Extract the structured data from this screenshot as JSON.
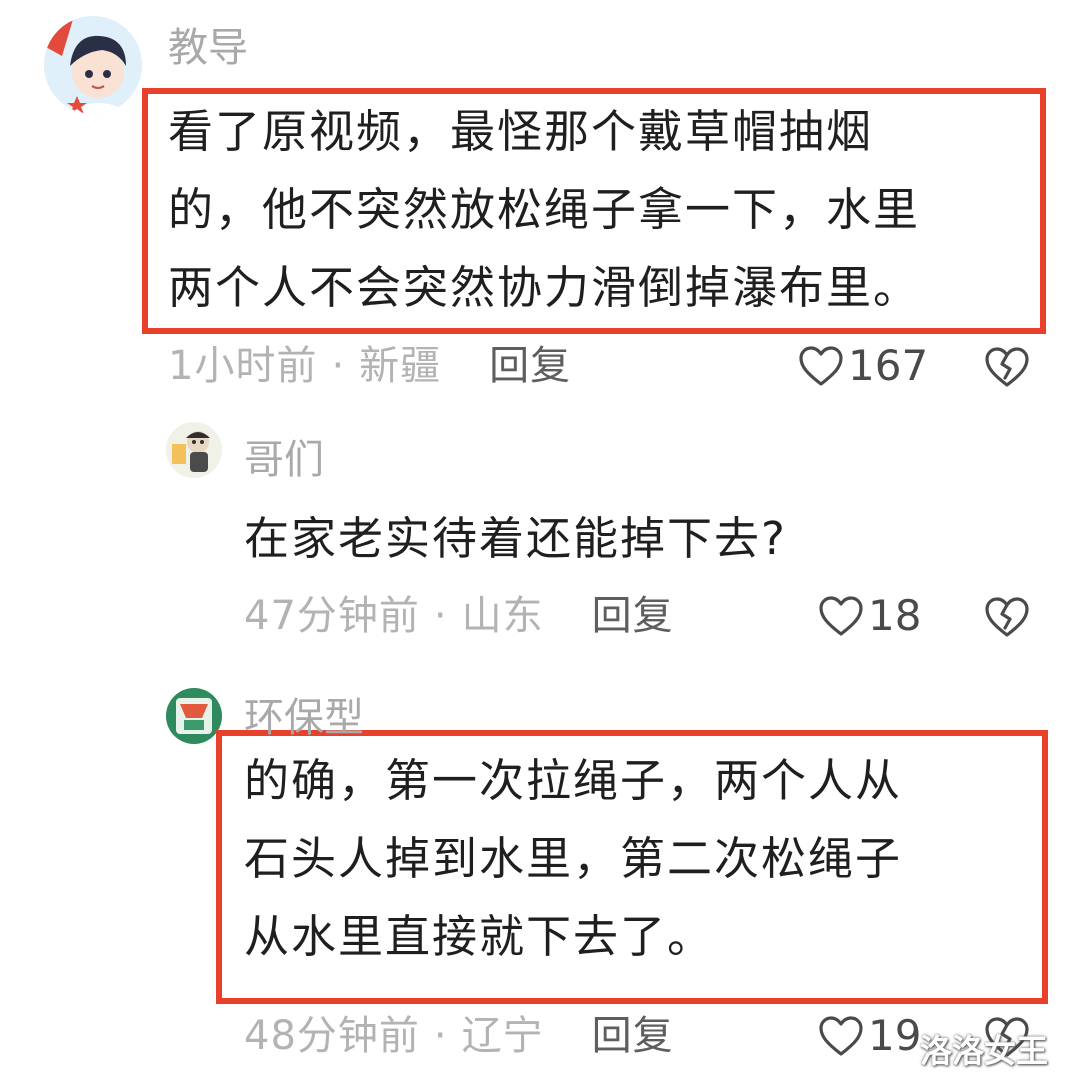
{
  "comments": [
    {
      "username": "教导",
      "text": "看了原视频，最怪那个戴草帽抽烟\n的，他不突然放松绳子拿一下，水里\n两个人不会突然协力滑倒掉瀑布里。",
      "time": "1小时前",
      "location": "新疆",
      "reply_label": "回复",
      "likes": "167",
      "highlighted": true,
      "avatar_icon": "cartoon-child-avatar"
    },
    {
      "username": "哥们",
      "text": "在家老实待着还能掉下去?",
      "time": "47分钟前",
      "location": "山东",
      "reply_label": "回复",
      "likes": "18",
      "highlighted": false,
      "avatar_icon": "figurine-avatar"
    },
    {
      "username": "环保型",
      "text": "的确，第一次拉绳子，两个人从\n石头人掉到水里，第二次松绳子\n从水里直接就下去了。",
      "time": "48分钟前",
      "location": "辽宁",
      "reply_label": "回复",
      "likes": "19",
      "highlighted": true,
      "avatar_icon": "green-logo-avatar"
    }
  ],
  "separator": "·",
  "watermark": "洛洛女王",
  "colors": {
    "highlight_border": "#e8402a",
    "meta_text": "#b3b3b3",
    "reply_text": "#5e5e5e",
    "comment_text": "#1f1f1f"
  }
}
